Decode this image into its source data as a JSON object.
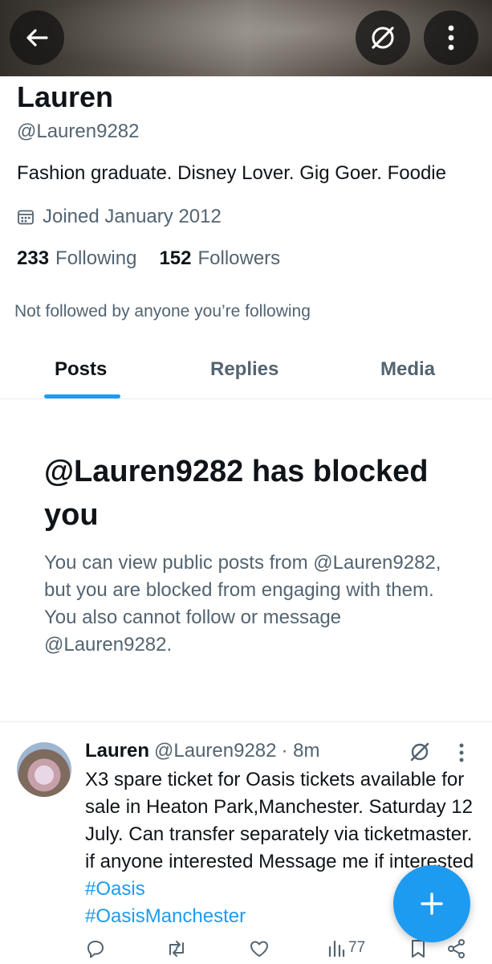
{
  "header": {
    "back_icon": "arrow-left-icon",
    "grok_icon": "grok-icon",
    "more_icon": "more-vertical-icon"
  },
  "profile": {
    "name": "Lauren",
    "handle": "@Lauren9282",
    "bio": "Fashion graduate. Disney Lover. Gig Goer. Foodie",
    "joined": "Joined January 2012",
    "following_count": "233",
    "following_label": "Following",
    "followers_count": "152",
    "followers_label": "Followers",
    "not_followed": "Not followed by anyone you’re following"
  },
  "tabs": [
    {
      "label": "Posts",
      "active": true
    },
    {
      "label": "Replies",
      "active": false
    },
    {
      "label": "Media",
      "active": false
    }
  ],
  "blocked": {
    "title": "@Lauren9282 has blocked you",
    "description": "You can view public posts from @Lauren9282, but you are blocked from engaging with them. You also cannot follow or message @Lauren9282."
  },
  "post": {
    "author_name": "Lauren",
    "author_handle": "@Lauren9282",
    "time": "· 8m",
    "text": "X3 spare ticket for Oasis tickets available for sale in Heaton Park,Manchester. Saturday 12 July. Can transfer separately via ticketmaster. if anyone interested Message me if interested",
    "hashtag_1": "#Oasis",
    "hashtag_2": "#OasisManchester",
    "views": "77"
  },
  "colors": {
    "accent": "#1d9bf0",
    "text_primary": "#0f1419",
    "text_secondary": "#536471"
  }
}
